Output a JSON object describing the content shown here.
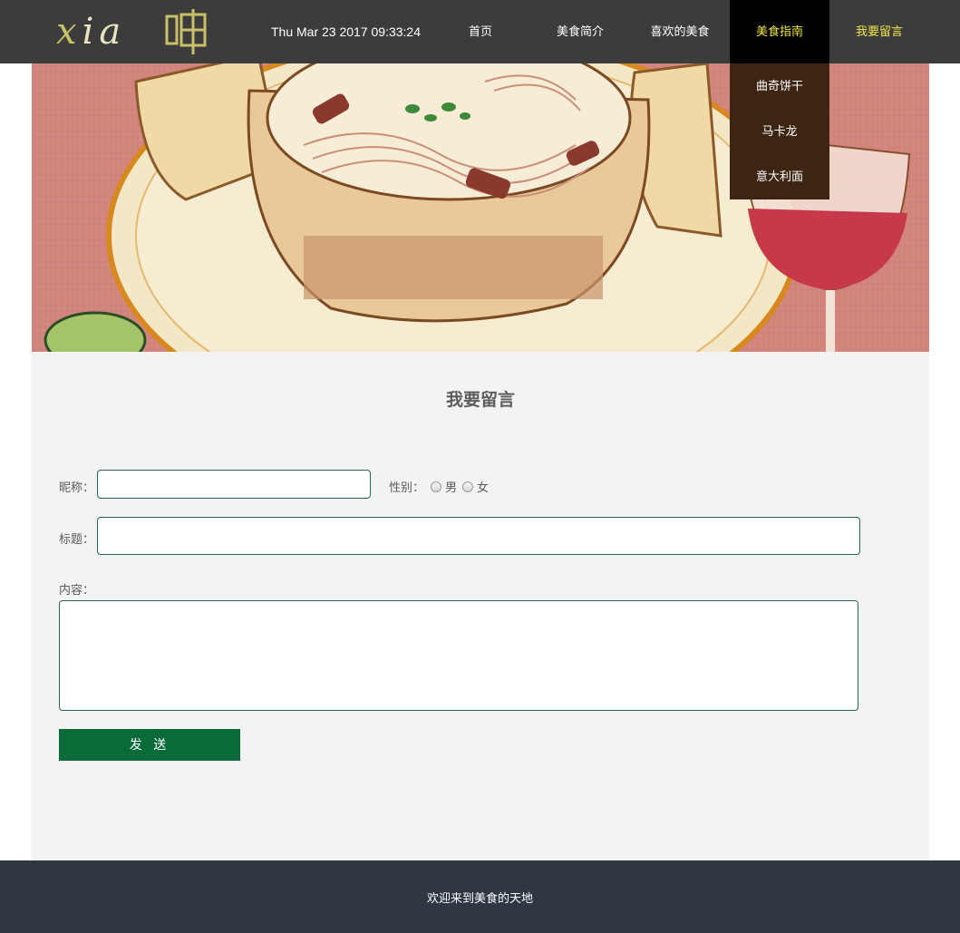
{
  "header": {
    "logo_part1": "x",
    "logo_part2": "ia",
    "logo_char_name": "jia-character-logo",
    "datetime": "Thu Mar 23 2017 09:33:24"
  },
  "nav": {
    "items": [
      {
        "label": "首页"
      },
      {
        "label": "美食简介"
      },
      {
        "label": "喜欢的美食"
      },
      {
        "label": "美食指南"
      },
      {
        "label": "我要留言"
      }
    ],
    "active_index": 3
  },
  "dropdown": {
    "items": [
      {
        "label": "曲奇饼干"
      },
      {
        "label": "马卡龙"
      },
      {
        "label": "意大利面"
      }
    ]
  },
  "form": {
    "title": "我要留言",
    "nickname_label": "昵称：",
    "nickname_value": "",
    "gender_label": "性别：",
    "gender_options": [
      "男",
      "女"
    ],
    "subject_label": "标题：",
    "subject_value": "",
    "content_label": "内容：",
    "content_value": "",
    "send_label": "发 送"
  },
  "footer": {
    "text": "欢迎来到美食的天地"
  },
  "colors": {
    "header_bg": "#3c3c3c",
    "nav_highlight": "#f2e64d",
    "dropdown_bg": "#3e2412",
    "button_green": "#0b6a3a",
    "footer_bg": "#2f3742"
  }
}
